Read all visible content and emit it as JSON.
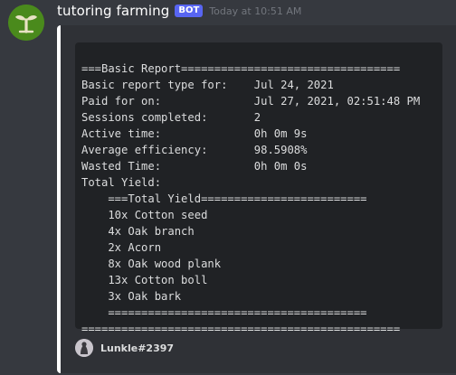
{
  "message": {
    "author": "tutoring farming",
    "bot_tag": "BOT",
    "timestamp": "Today at 10:51 AM",
    "avatar_icon": "sprout-icon",
    "accent_color": "#ffffff"
  },
  "embed": {
    "code_lines": [
      "===Basic Report=================================",
      "Basic report type for:    Jul 24, 2021",
      "Paid for on:              Jul 27, 2021, 02:51:48 PM",
      "Sessions completed:       2",
      "Active time:              0h 0m 9s",
      "Average efficiency:       98.5908%",
      "Wasted Time:              0h 0m 0s",
      "Total Yield:",
      "    ===Total Yield=========================",
      "    10x Cotton seed",
      "    4x Oak branch",
      "    2x Acorn",
      "    8x Oak wood plank",
      "    13x Cotton boll",
      "    3x Oak bark",
      "    =======================================",
      "================================================"
    ],
    "footer_text": "Lunkle#2397",
    "footer_icon": "user-avatar-icon"
  }
}
